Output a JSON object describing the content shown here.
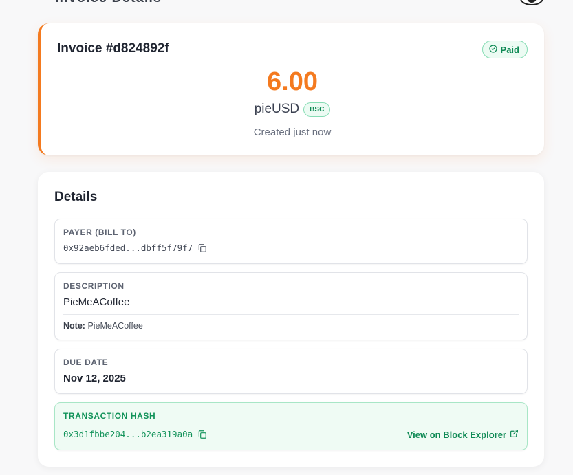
{
  "header": {
    "title_fragment": "Invoice Details"
  },
  "invoice": {
    "title": "Invoice #d824892f",
    "status": "Paid",
    "amount": "6.00",
    "currency": "pieUSD",
    "chain": "BSC",
    "created": "Created just now"
  },
  "details": {
    "title": "Details",
    "payer": {
      "label": "PAYER (BILL TO)",
      "value": "0x92aeb6fded...dbff5f79f7"
    },
    "description": {
      "label": "DESCRIPTION",
      "value": "PieMeACoffee",
      "note_label": "Note:",
      "note_value": "PieMeACoffee"
    },
    "due_date": {
      "label": "DUE DATE",
      "value": "Nov 12, 2025"
    },
    "transaction": {
      "label": "TRANSACTION HASH",
      "value": "0x3d1fbbe204...b2ea319a0a",
      "explorer_link": "View on Block Explorer"
    }
  },
  "colors": {
    "accent": "#f47a1f",
    "success": "#0f8a55",
    "success_bg": "#ecfbf3"
  },
  "icons": {
    "status": "check-circle-icon",
    "copy": "copy-icon",
    "external": "external-link-icon"
  }
}
